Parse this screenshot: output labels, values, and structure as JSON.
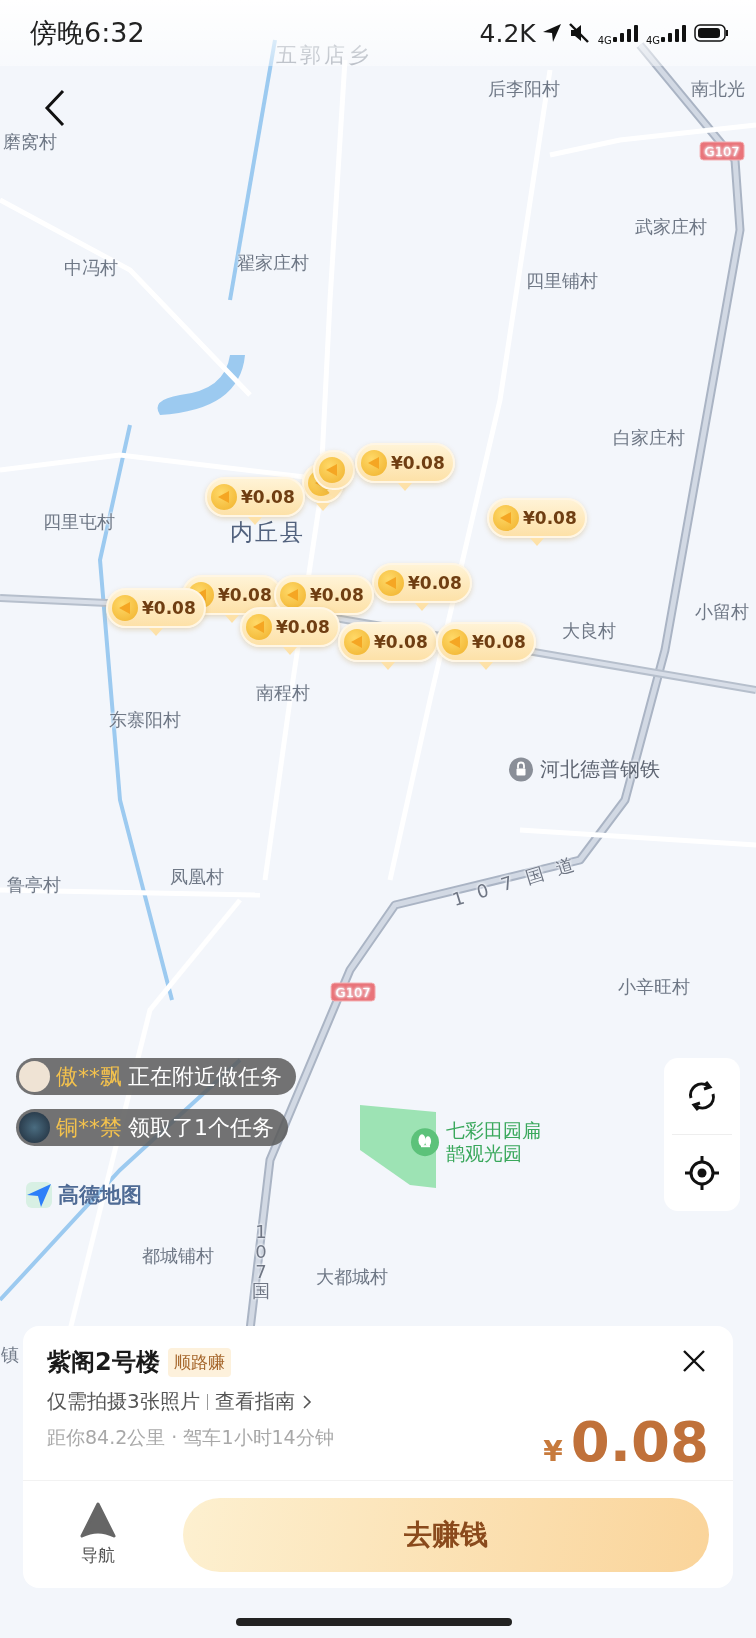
{
  "status_bar": {
    "time": "傍晚6:32",
    "speed": "4.2K",
    "sim1": "4G",
    "sim2": "4G"
  },
  "map_labels": [
    {
      "text": "五郭店乡",
      "kind": "town"
    },
    {
      "text": "后李阳村",
      "kind": "village"
    },
    {
      "text": "南北光",
      "kind": "village"
    },
    {
      "text": "G107",
      "kind": "badge"
    },
    {
      "text": "磨窝村",
      "kind": "village"
    },
    {
      "text": "中冯村",
      "kind": "village"
    },
    {
      "text": "翟家庄村",
      "kind": "village"
    },
    {
      "text": "武家庄村",
      "kind": "village"
    },
    {
      "text": "四里铺村",
      "kind": "village"
    },
    {
      "text": "白家庄村",
      "kind": "village"
    },
    {
      "text": "四里屯村",
      "kind": "village"
    },
    {
      "text": "内丘县",
      "kind": "county"
    },
    {
      "text": "小留村",
      "kind": "village"
    },
    {
      "text": "大良村",
      "kind": "village"
    },
    {
      "text": "南程村",
      "kind": "village"
    },
    {
      "text": "东寨阳村",
      "kind": "village"
    },
    {
      "text": "河北德普钢铁",
      "kind": "company"
    },
    {
      "text": "107国道",
      "kind": "road"
    },
    {
      "text": "鲁亭村",
      "kind": "village"
    },
    {
      "text": "凤凰村",
      "kind": "village"
    },
    {
      "text": "G107",
      "kind": "badge"
    },
    {
      "text": "小辛旺村",
      "kind": "village"
    },
    {
      "text": "七彩田园扁鹊观光园",
      "kind": "park"
    },
    {
      "text": "都城铺村",
      "kind": "village"
    },
    {
      "text": "大都城村",
      "kind": "village"
    },
    {
      "text": "107国",
      "kind": "road-vertical"
    },
    {
      "text": "镇",
      "kind": "village"
    }
  ],
  "markers": [
    {
      "kind": "covered"
    },
    {
      "kind": "covered"
    },
    {
      "kind": "price",
      "price": "¥0.08"
    },
    {
      "kind": "price",
      "price": "¥0.08"
    },
    {
      "kind": "price",
      "price": "¥0.08"
    },
    {
      "kind": "price",
      "price": "¥0.08"
    },
    {
      "kind": "price",
      "price": "¥0.08"
    },
    {
      "kind": "price",
      "price": "¥0.08"
    },
    {
      "kind": "price",
      "price": "¥0.08"
    },
    {
      "kind": "price",
      "price": "¥0.08"
    },
    {
      "kind": "price",
      "price": "¥0.08"
    },
    {
      "kind": "price",
      "price": "¥0.08"
    }
  ],
  "activity_feed": [
    {
      "name": "傲**飘",
      "action": "正在附近做任务",
      "kind": "plain"
    },
    {
      "name": "铜**禁",
      "action": "领取了1个任务",
      "kind": "photo"
    }
  ],
  "map_logo": "高德地图",
  "task_card": {
    "title": "紫阁2号楼",
    "tag": "顺路赚",
    "requirement": "仅需拍摄3张照片",
    "guide_link": "查看指南",
    "distance": "距你84.2公里 · 驾车1小时14分钟",
    "currency": "¥",
    "price": "0.08",
    "nav_label": "导航",
    "action_button": "去赚钱"
  }
}
